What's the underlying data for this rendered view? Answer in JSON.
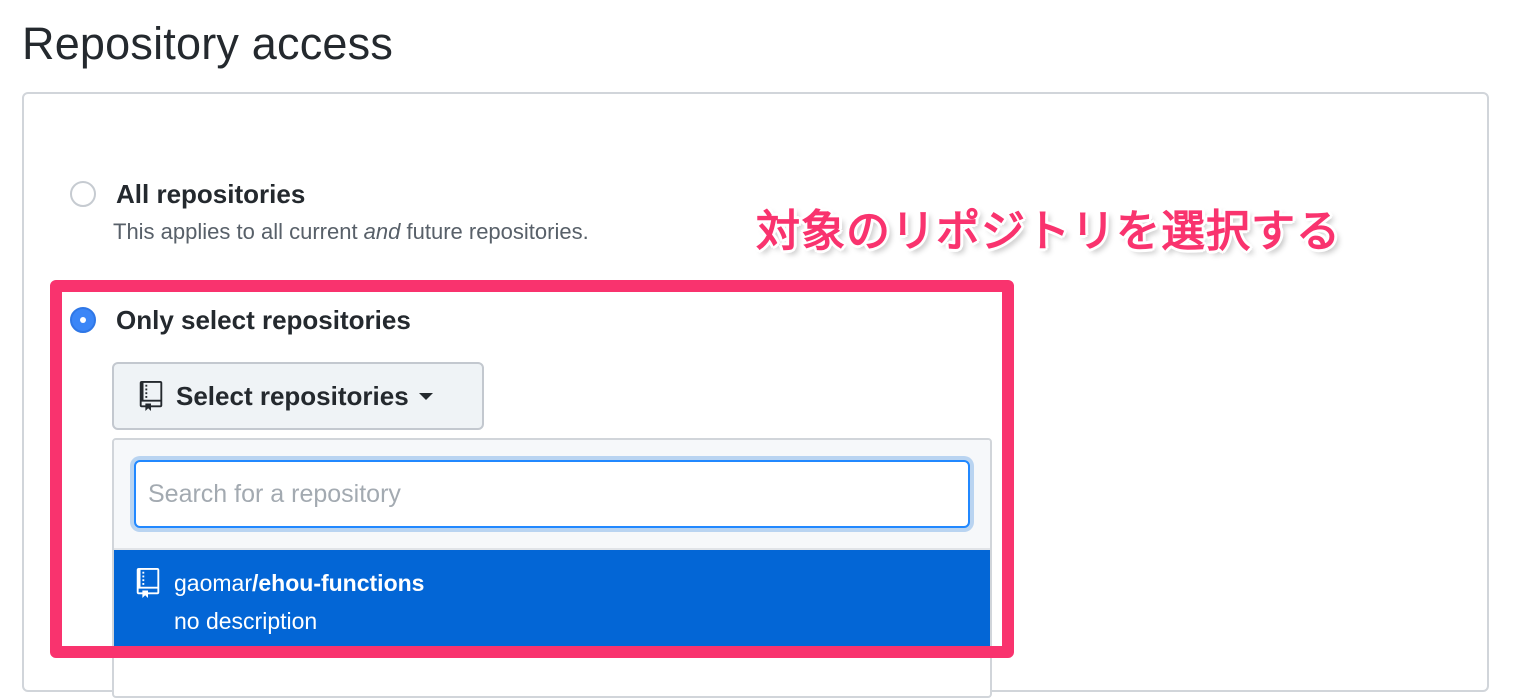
{
  "page": {
    "title": "Repository access"
  },
  "options": {
    "all": {
      "label": "All repositories",
      "desc_prefix": "This applies to all current ",
      "desc_em": "and",
      "desc_suffix": " future repositories.",
      "selected": false
    },
    "only": {
      "label": "Only select repositories",
      "selected": true
    }
  },
  "select_button": {
    "label": "Select repositories",
    "icon": "repo-icon"
  },
  "search": {
    "placeholder": "Search for a repository",
    "value": ""
  },
  "repos": [
    {
      "owner": "gaomar",
      "separator": "/",
      "name": "ehou-functions",
      "description": "no description",
      "icon": "repo-icon"
    }
  ],
  "annotation": {
    "text": "対象のリポジトリを選択する",
    "color": "#f9336e"
  },
  "colors": {
    "accent": "#0366d6",
    "radio_selected": "#3b86f7",
    "highlight": "#f9336e"
  }
}
